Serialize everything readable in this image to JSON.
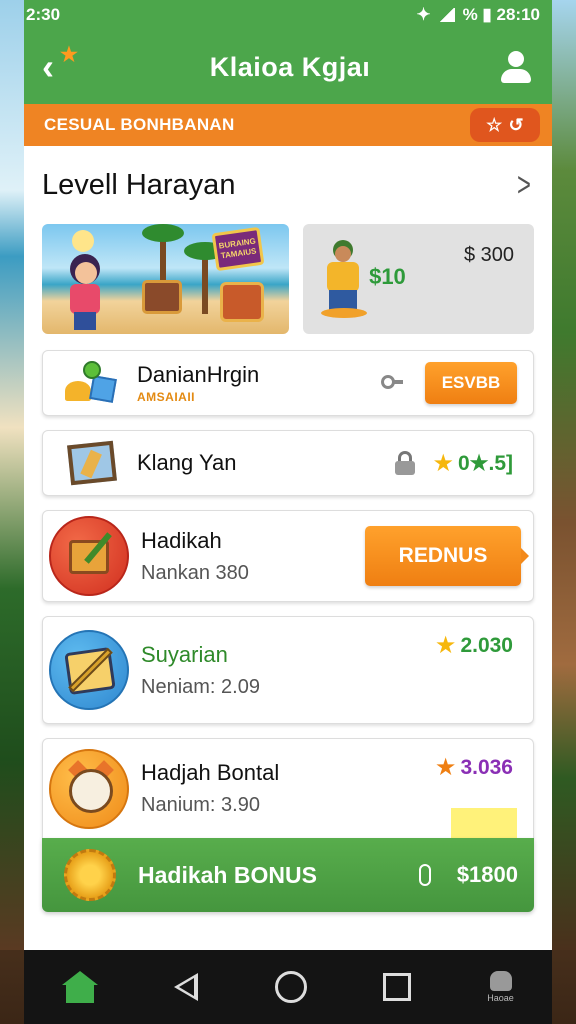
{
  "status_bar": {
    "time": "2:30",
    "right_text": "% ▮ 28:10"
  },
  "app_bar": {
    "title": "Klaioa Kgjaı"
  },
  "banner": {
    "text": "CESUAL BONHBANAN"
  },
  "section": {
    "title": "Levell Harayan"
  },
  "promo": {
    "sign_text": "BURAING TAMAIUS",
    "card2_green_text": "$10",
    "card2_price": "$ 300"
  },
  "rows": [
    {
      "name": "DanianHrgin",
      "sub": "AMSAIAII",
      "button": "ESVBB"
    },
    {
      "name": "Klang Yan",
      "value": "0★.5]"
    },
    {
      "name": "Hadikah",
      "sub": "Nankan 380",
      "button": "REDNUS"
    },
    {
      "name": "Suyarian",
      "sub": "Neniam: 2.09",
      "value": "2.030"
    },
    {
      "name": "Hadjah Bontal",
      "sub": "Nanium: 3.90",
      "value": "3.036"
    }
  ],
  "bonus_bar": {
    "label": "Hadikah BONUS",
    "amount": "$1800"
  },
  "nav": {
    "profile_label": "Haoae"
  },
  "colors": {
    "primary_green": "#4ca64b",
    "accent_orange": "#ef8423",
    "value_purple": "#8a2fb5"
  }
}
